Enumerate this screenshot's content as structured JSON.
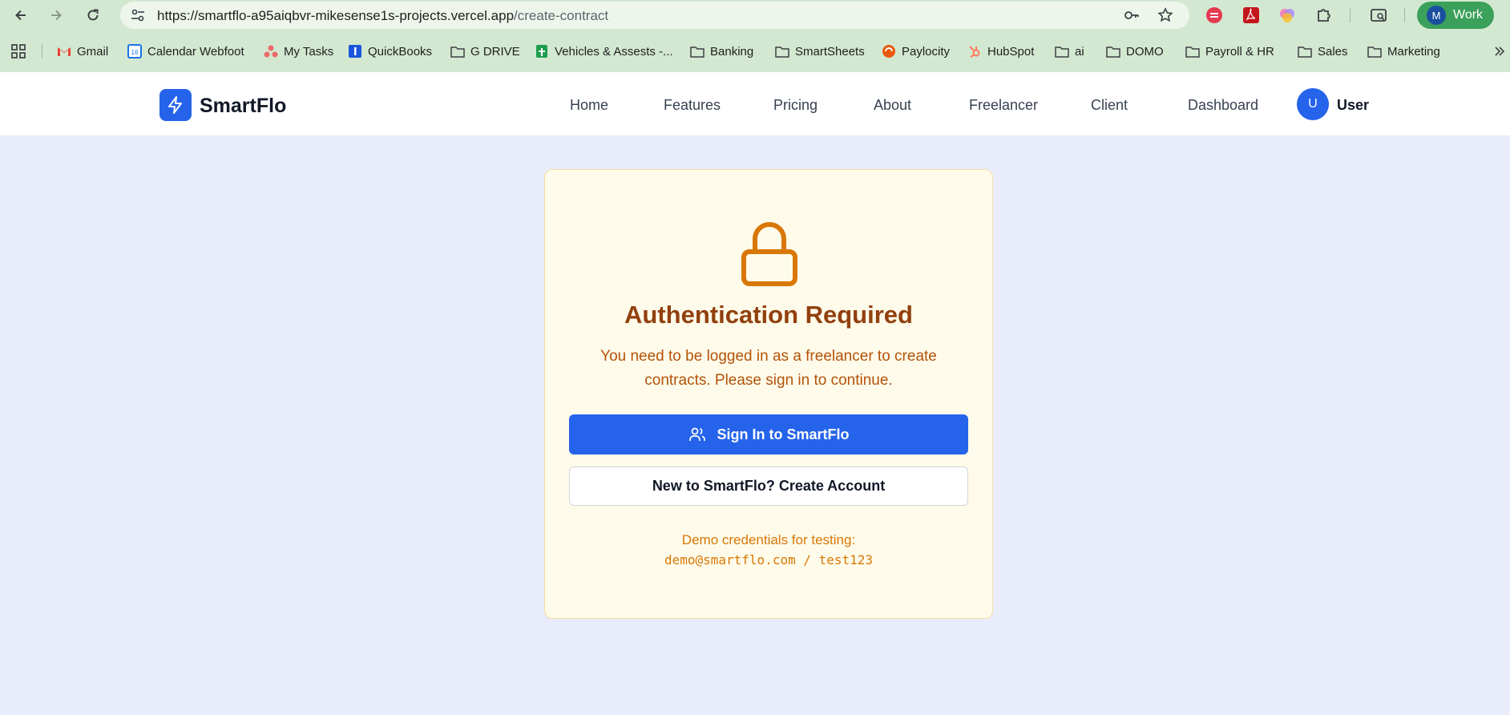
{
  "browser": {
    "url_host": "https://smartflo-a95aiqbvr-mikesense1s-projects.vercel.app",
    "url_path": "/create-contract",
    "profile_initial": "M",
    "profile_name": "Work"
  },
  "bookmarks": [
    {
      "label": "Gmail",
      "icon": "gmail-icon"
    },
    {
      "label": "Calendar Webfoot",
      "icon": "calendar-icon"
    },
    {
      "label": "My Tasks",
      "icon": "asana-icon"
    },
    {
      "label": "QuickBooks",
      "icon": "quickbooks-icon"
    },
    {
      "label": "G DRIVE",
      "icon": "folder-icon"
    },
    {
      "label": "Vehicles & Assests -...",
      "icon": "sheets-icon"
    },
    {
      "label": "Banking",
      "icon": "folder-icon"
    },
    {
      "label": "SmartSheets",
      "icon": "folder-icon"
    },
    {
      "label": "Paylocity",
      "icon": "paylocity-icon"
    },
    {
      "label": "HubSpot",
      "icon": "hubspot-icon"
    },
    {
      "label": "ai",
      "icon": "folder-icon"
    },
    {
      "label": "DOMO",
      "icon": "folder-icon"
    },
    {
      "label": "Payroll & HR",
      "icon": "folder-icon"
    },
    {
      "label": "Sales",
      "icon": "folder-icon"
    },
    {
      "label": "Marketing",
      "icon": "folder-icon"
    }
  ],
  "app": {
    "brand": "SmartFlo",
    "nav": [
      "Home",
      "Features",
      "Pricing",
      "About",
      "Freelancer",
      "Client",
      "Dashboard"
    ],
    "user_initial": "U",
    "user_name": "User"
  },
  "auth": {
    "title": "Authentication Required",
    "message": "You need to be logged in as a freelancer to create contracts. Please sign in to continue.",
    "sign_in_label": "Sign In to SmartFlo",
    "create_account_label": "New to SmartFlo? Create Account",
    "demo_label": "Demo credentials for testing:",
    "demo_credentials": "demo@smartflo.com / test123"
  },
  "colors": {
    "primary": "#2563eb",
    "card_bg": "#fefbea",
    "warning_text": "#92400e",
    "accent_orange": "#d97706"
  }
}
